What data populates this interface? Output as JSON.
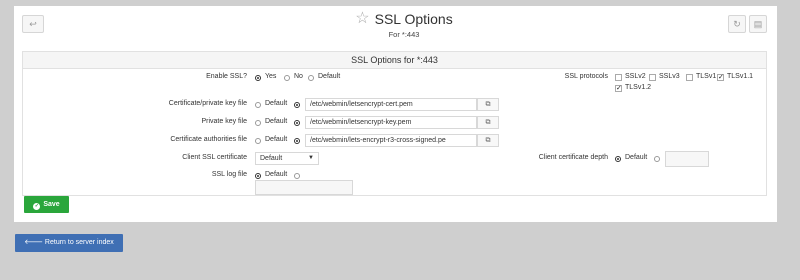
{
  "header": {
    "title": "SSL Options",
    "subtitle": "For *:443",
    "icons": {
      "back": "arrow-left-icon",
      "refresh": "refresh-icon",
      "menu": "menu-icon",
      "star": "star-icon"
    }
  },
  "section": {
    "title": "SSL Options for *:443"
  },
  "enable_ssl": {
    "label": "Enable SSL?",
    "options": [
      "Yes",
      "No",
      "Default"
    ],
    "selected": "Yes"
  },
  "ssl_protocols": {
    "label": "SSL protocols",
    "items": [
      {
        "label": "SSLv2",
        "checked": false
      },
      {
        "label": "SSLv3",
        "checked": false
      },
      {
        "label": "TLSv1",
        "checked": false
      },
      {
        "label": "TLSv1.1",
        "checked": true
      },
      {
        "label": "TLSv1.2",
        "checked": true
      }
    ]
  },
  "cert_file": {
    "label": "Certificate/private key file",
    "default_label": "Default",
    "value": "/etc/webmin/letsencrypt-cert.pem"
  },
  "private_key": {
    "label": "Private key file",
    "default_label": "Default",
    "value": "/etc/webmin/letsencrypt-key.pem"
  },
  "ca_file": {
    "label": "Certificate authorities file",
    "default_label": "Default",
    "value": "/etc/webmin/lets-encrypt-r3-cross-signed.pe"
  },
  "client_cert": {
    "label": "Client SSL certificate",
    "value": "Default"
  },
  "client_depth": {
    "label": "Client certificate depth",
    "default_label": "Default",
    "value": ""
  },
  "ssl_log": {
    "label": "SSL log file",
    "default_label": "Default",
    "value": ""
  },
  "buttons": {
    "save": "Save",
    "return": "Return to server index"
  },
  "colors": {
    "save": "#2aa63b",
    "return": "#3f6fb4",
    "background": "#cfcfcf"
  }
}
